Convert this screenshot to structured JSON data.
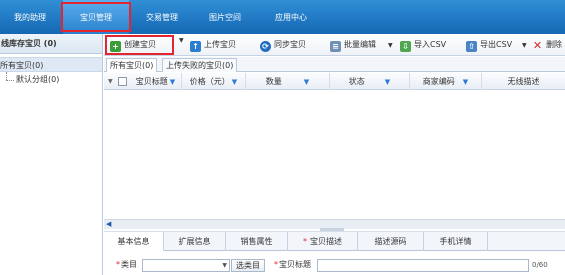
{
  "nav": {
    "tabs": [
      {
        "label": "我的助理"
      },
      {
        "label": "宝贝管理"
      },
      {
        "label": "交易管理"
      },
      {
        "label": "图片空间"
      },
      {
        "label": "应用中心"
      }
    ],
    "active_index": 1
  },
  "sidebar": {
    "title": "线库存宝贝 (0)",
    "root": "所有宝贝(0)",
    "child": "默认分组(0)"
  },
  "toolbar": {
    "create": "创建宝贝",
    "upload": "上传宝贝",
    "sync": "同步宝贝",
    "batch_edit": "批量编辑",
    "import_csv": "导入CSV",
    "export_csv": "导出CSV",
    "delete": "删除"
  },
  "subtabs": {
    "all": "所有宝贝(0)",
    "failed": "上传失败的宝贝(0)"
  },
  "table": {
    "columns": [
      "宝贝标题",
      "价格（元）",
      "数量",
      "状态",
      "商家编码",
      "无线描述"
    ]
  },
  "bottom_tabs": {
    "basic": "基本信息",
    "ext": "扩展信息",
    "sale_attr": "销售属性",
    "desc": "宝贝描述",
    "desc_code": "描述源码",
    "mobile": "手机详情"
  },
  "form": {
    "category_label": "类目",
    "select_category": "选类目",
    "title_label": "宝贝标题",
    "counter": "0/60"
  },
  "colors": {
    "nav_blue": "#1f78c4",
    "highlight_red": "#e3262e"
  }
}
